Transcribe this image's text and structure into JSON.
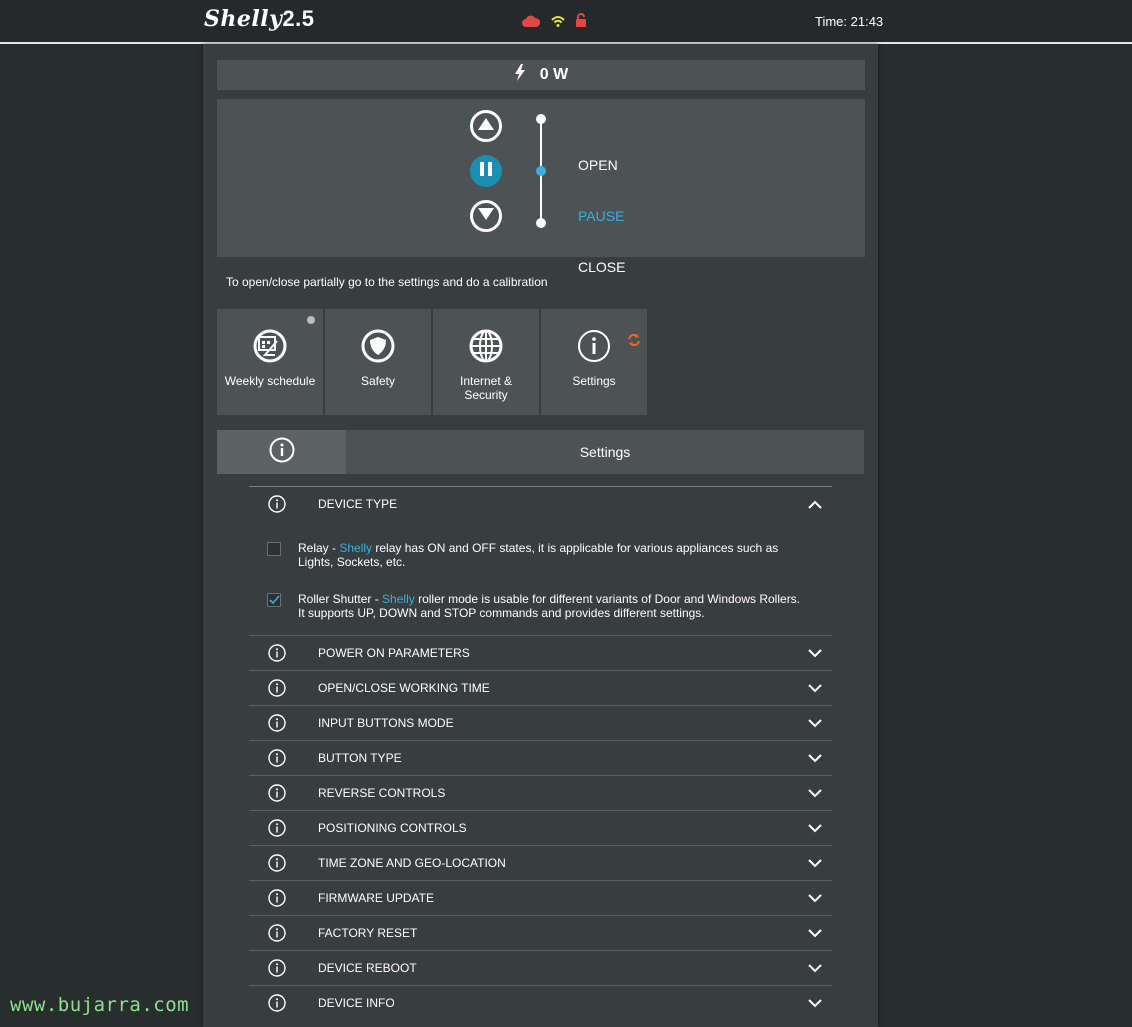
{
  "header": {
    "brand": "Shelly",
    "version": "2.5",
    "time_label": "Time: 21:43",
    "icons": [
      "cloud-icon",
      "wifi-icon",
      "unlock-icon"
    ],
    "colors": {
      "cloud": "#e04848",
      "wifi": "#e8e23a",
      "lock": "#e04848"
    }
  },
  "power": {
    "value": "0 W"
  },
  "roller": {
    "open_label": "OPEN",
    "pause_label": "PAUSE",
    "close_label": "CLOSE",
    "state": "pause"
  },
  "hint": "To open/close partially go to the settings and do a calibration",
  "tiles": [
    {
      "label": "Weekly schedule",
      "icon": "schedule-icon"
    },
    {
      "label": "Safety",
      "icon": "shield-icon"
    },
    {
      "label": "Internet & Security",
      "icon": "globe-icon"
    },
    {
      "label": "Settings",
      "icon": "info-icon"
    }
  ],
  "section": {
    "title": "Settings"
  },
  "device_type": {
    "title": "DEVICE TYPE",
    "relay": {
      "name": "Relay",
      "sep": " - ",
      "brand": "Shelly",
      "desc": " relay has ON and OFF states, it is applicable for various appliances such as Lights, Sockets, etc.",
      "checked": false
    },
    "roller": {
      "name": "Roller Shutter",
      "sep": " - ",
      "brand": "Shelly",
      "desc": " roller mode is usable for different variants of Door and Windows Rollers. It supports UP, DOWN and STOP commands and provides different settings.",
      "checked": true
    }
  },
  "settings_items": [
    "POWER ON PARAMETERS",
    "OPEN/CLOSE WORKING TIME",
    "INPUT BUTTONS MODE",
    "BUTTON TYPE",
    "REVERSE CONTROLS",
    "POSITIONING CONTROLS",
    "TIME ZONE AND GEO-LOCATION",
    "FIRMWARE UPDATE",
    "FACTORY RESET",
    "DEVICE REBOOT",
    "DEVICE INFO"
  ],
  "watermark": "www.bujarra.com"
}
